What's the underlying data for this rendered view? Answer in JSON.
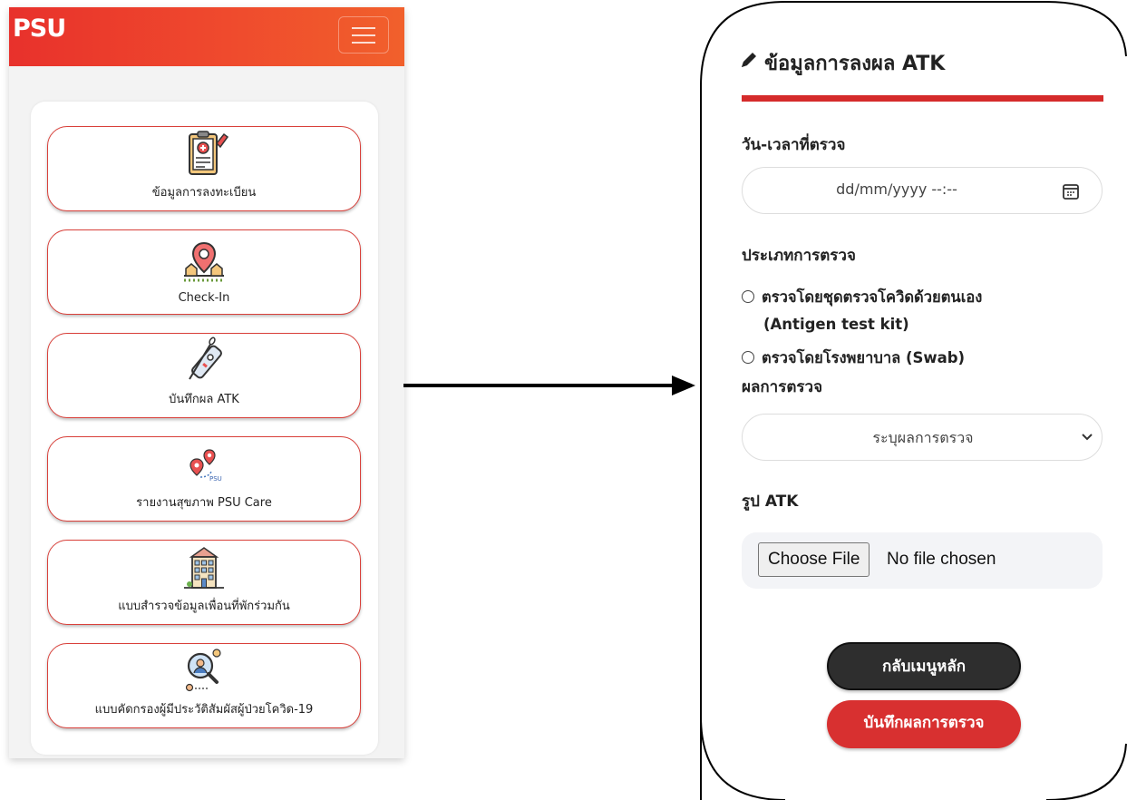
{
  "left_app": {
    "logo_text": "PSU",
    "menu_items": [
      {
        "label": "ข้อมูลการลงทะเบียน",
        "icon": "clipboard-medical-icon"
      },
      {
        "label": "Check-In",
        "icon": "location-pin-icon"
      },
      {
        "label": "บันทึกผล ATK",
        "icon": "atk-test-kit-icon"
      },
      {
        "label": "รายงานสุขภาพ PSU Care",
        "icon": "route-map-icon"
      },
      {
        "label": "แบบสำรวจข้อมูลเพื่อนที่พักร่วมกัน",
        "icon": "building-icon"
      },
      {
        "label": "แบบคัดกรองผู้มีประวัติสัมผัสผู้ป่วยโควิด-19",
        "icon": "contact-search-icon"
      }
    ]
  },
  "form": {
    "title": "ข้อมูลการลงผล ATK",
    "datetime_label": "วัน-เวลาที่ตรวจ",
    "datetime_placeholder": "dd/mm/yyyy --:--",
    "test_type_label": "ประเภทการตรวจ",
    "test_type_options": [
      {
        "line1": "ตรวจโดยชุดตรวจโควิดด้วยตนเอง",
        "line2": "(Antigen test kit)"
      },
      {
        "line1": "ตรวจโดยโรงพยาบาล (Swab)"
      }
    ],
    "result_label": "ผลการตรวจ",
    "result_selected": "ระบุผลการตรวจ",
    "photo_label": "รูป ATK",
    "file_button": "Choose File",
    "file_status": "No file chosen",
    "back_button": "กลับเมนูหลัก",
    "submit_button": "บันทึกผลการตรวจ"
  },
  "colors": {
    "accent_red": "#d83030",
    "navbar_red": "#e8312c",
    "dark_button": "#2e2e2e"
  }
}
